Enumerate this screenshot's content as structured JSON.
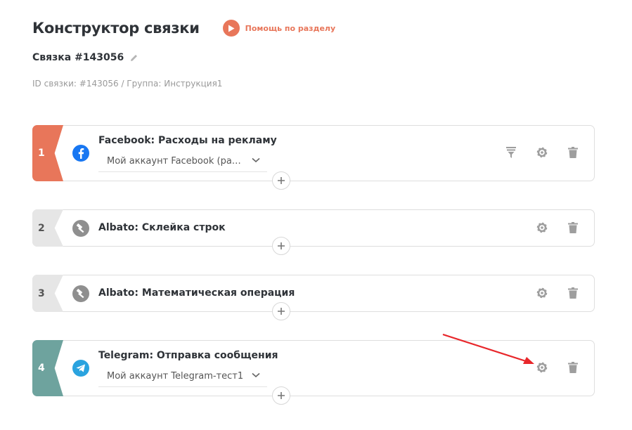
{
  "header": {
    "title": "Конструктор связки",
    "help_label": "Помощь по разделу"
  },
  "bundle": {
    "name": "Связка #143056",
    "meta": "ID связки: #143056 / Группа: Инструкция1"
  },
  "steps": [
    {
      "number": "1",
      "title": "Facebook: Расходы на рекламу",
      "account": "Мой аккаунт Facebook (расходы)",
      "icon": "facebook-icon",
      "actions": [
        "filter-icon",
        "gear-icon",
        "trash-icon"
      ]
    },
    {
      "number": "2",
      "title": "Albato: Склейка строк",
      "icon": "hammer-icon",
      "actions": [
        "gear-icon",
        "trash-icon"
      ]
    },
    {
      "number": "3",
      "title": "Albato: Математическая операция",
      "icon": "hammer-icon",
      "actions": [
        "gear-icon",
        "trash-icon"
      ]
    },
    {
      "number": "4",
      "title": "Telegram: Отправка сообщения",
      "account": "Мой аккаунт Telegram-тест1",
      "icon": "telegram-icon",
      "actions": [
        "gear-icon",
        "trash-icon"
      ]
    }
  ],
  "colors": {
    "accent": "#e8765a",
    "step4_badge": "#6ea39e",
    "neutral_badge": "#e6e6e6",
    "icon_gray": "#9e9e9e",
    "annotation_arrow": "#e8262a"
  }
}
